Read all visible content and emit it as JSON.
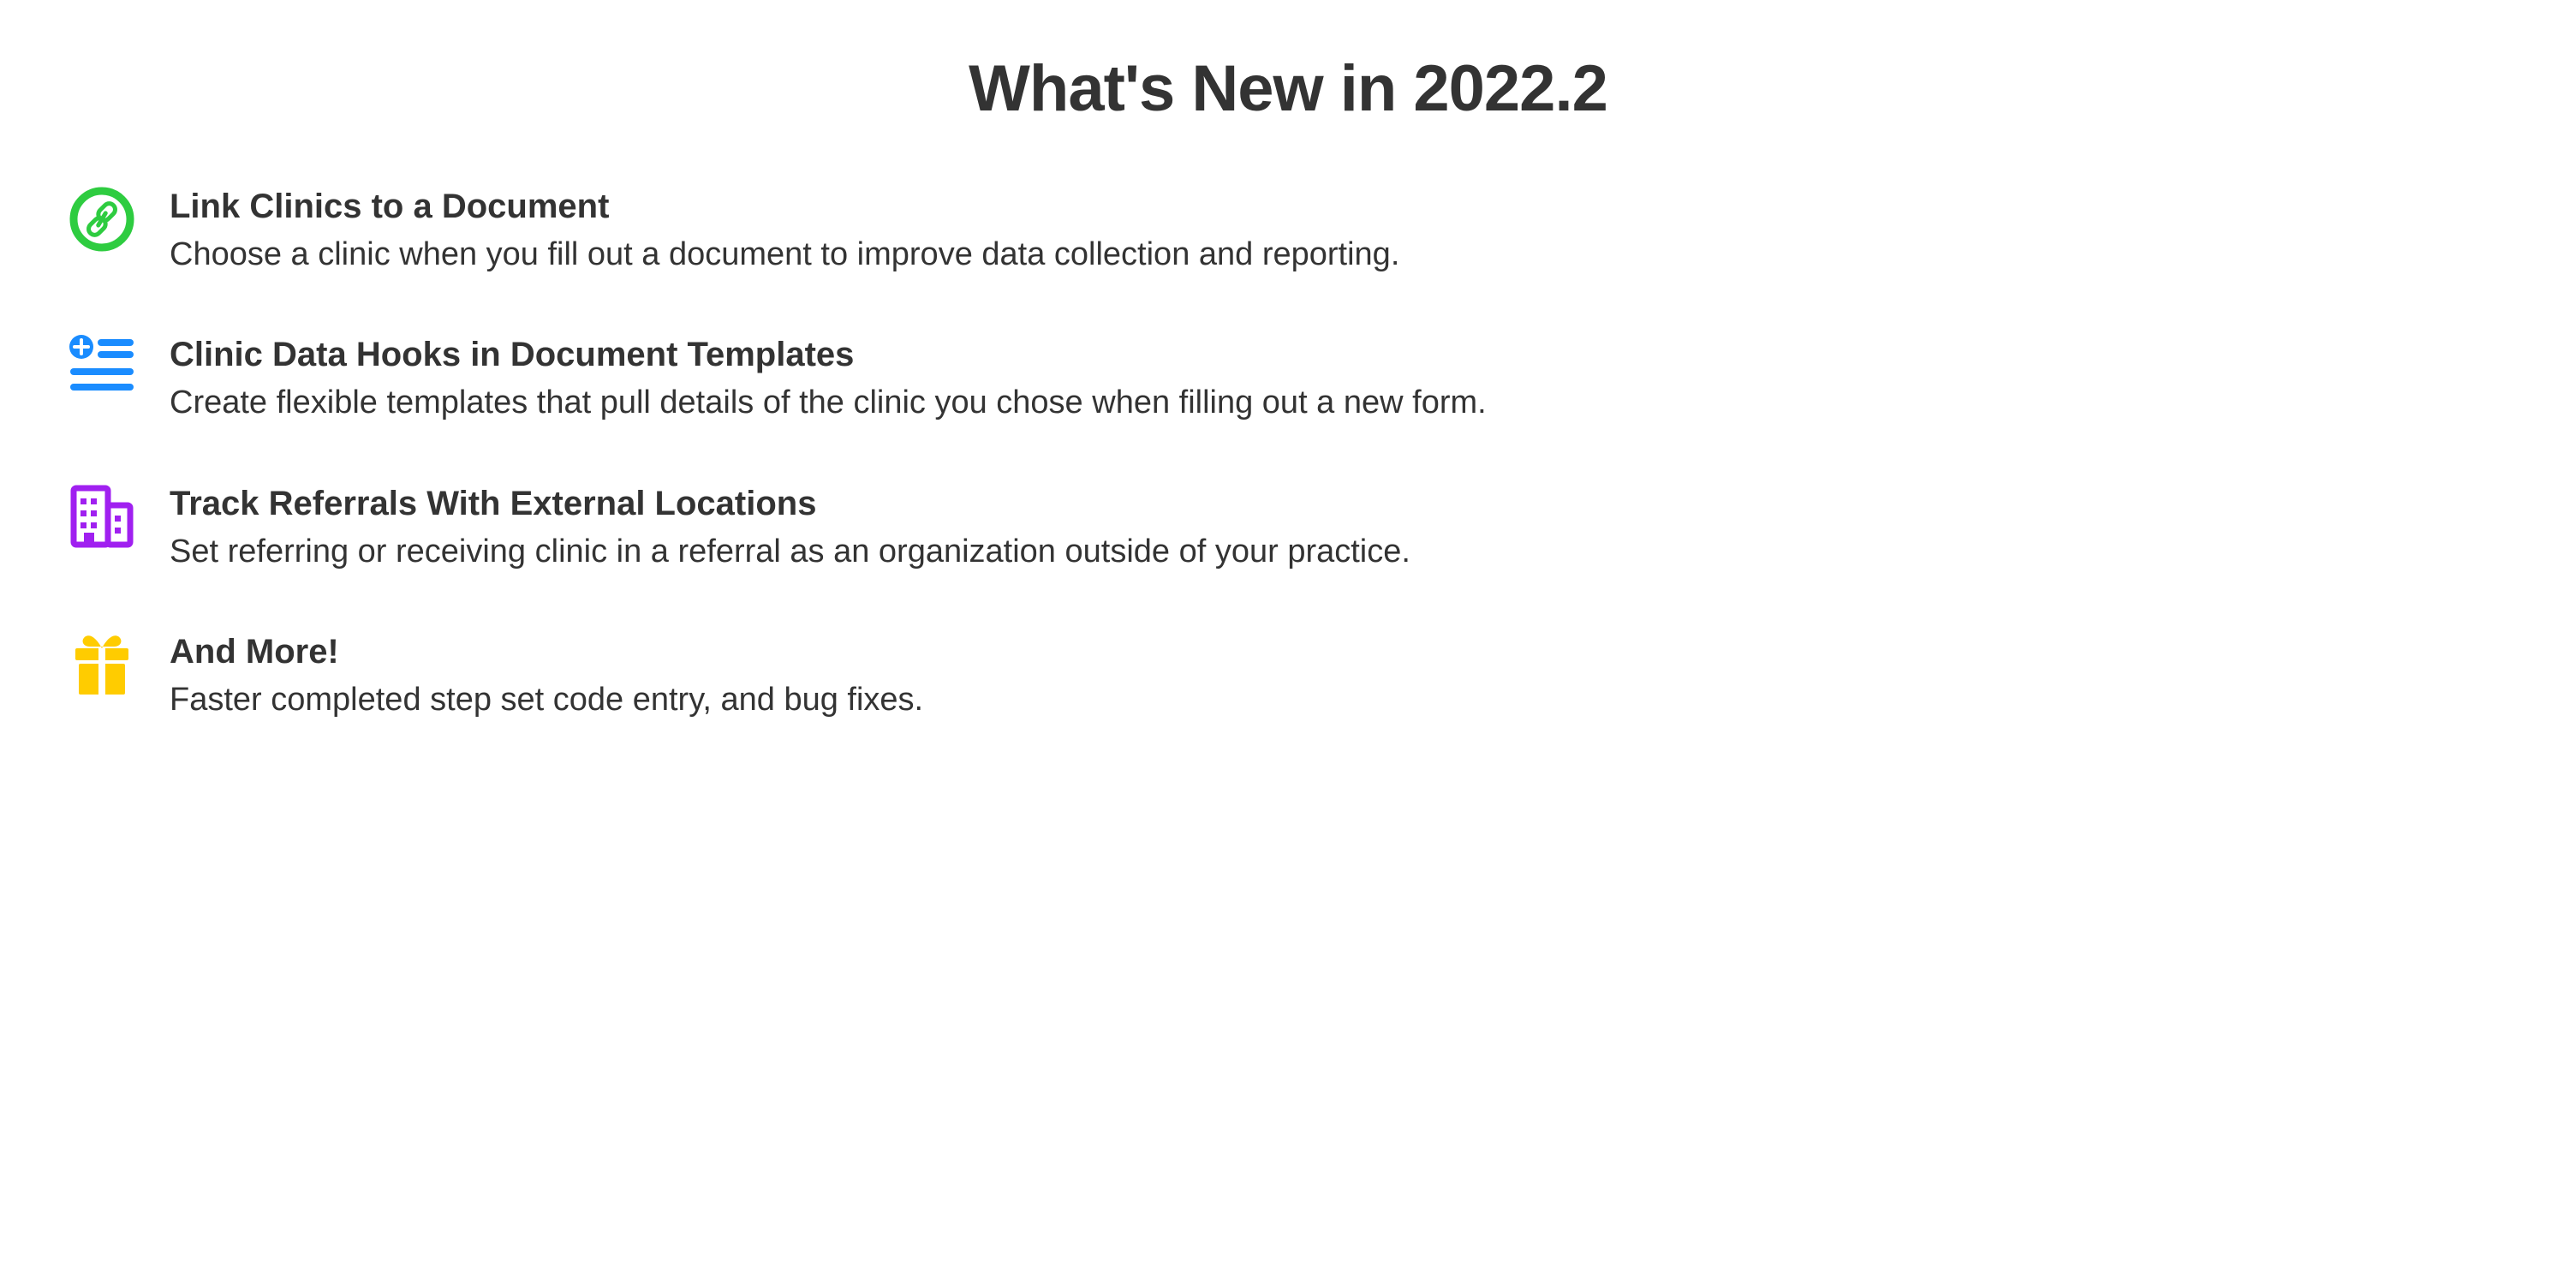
{
  "title": "What's New in 2022.2",
  "features": [
    {
      "title": "Link Clinics to a Document",
      "description": "Choose a clinic when you fill out a document to improve data collection and reporting."
    },
    {
      "title": "Clinic Data Hooks in Document Templates",
      "description": "Create flexible templates that pull details of the clinic you chose when filling out a new form."
    },
    {
      "title": "Track Referrals With External Locations",
      "description": "Set referring or receiving clinic in a referral as an organization outside of your practice."
    },
    {
      "title": "And More!",
      "description": "Faster completed step set code entry, and bug fixes."
    }
  ]
}
